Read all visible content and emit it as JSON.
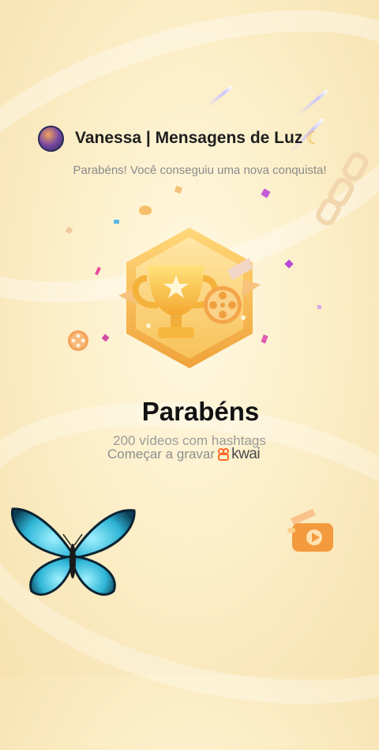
{
  "header": {
    "username": "Vanessa | Mensagens de Luz"
  },
  "subtitle": "Parabéns! Você conseguiu uma nova conquista!",
  "achievement": {
    "title": "Parabéns",
    "description": "200 vídeos com hashtags",
    "cta_label": "Começar a gravar",
    "brand": "kwai"
  },
  "colors": {
    "brand_orange": "#ff6a2b",
    "badge_gold": "#f6b73a",
    "text_dark": "#1e1e1e",
    "text_gray": "#8a8a8a"
  },
  "icons": {
    "avatar": "avatar-image",
    "moon": "crescent-moon-icon",
    "badge": "trophy-film-reel-badge",
    "butterfly": "butterfly-sticker",
    "kwai": "kwai-logo-icon"
  }
}
